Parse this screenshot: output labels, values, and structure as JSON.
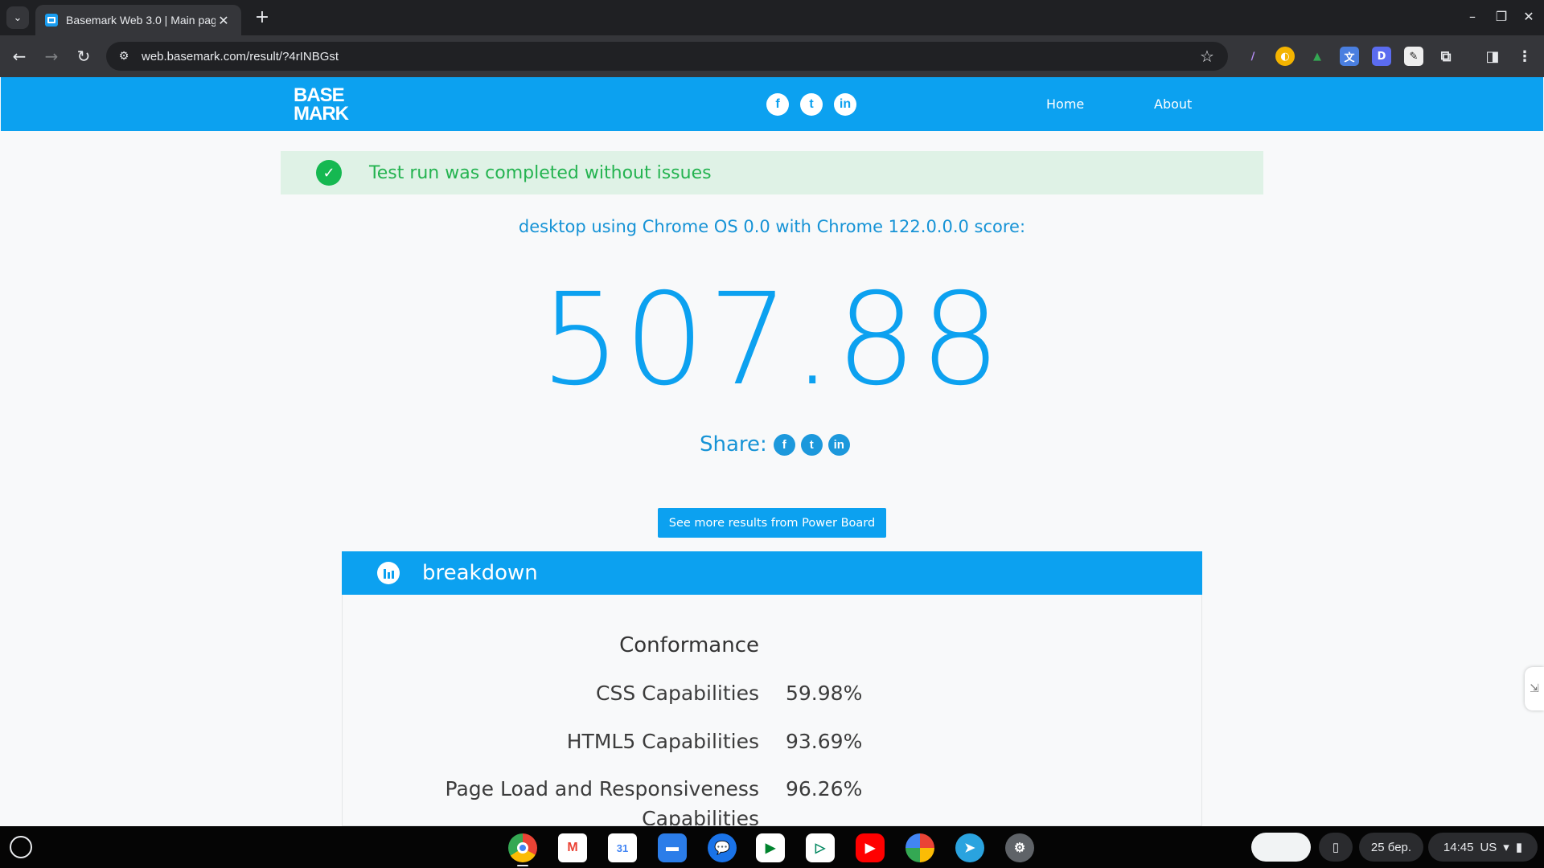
{
  "browser": {
    "tab_title": "Basemark Web 3.0 | Main page",
    "url": "web.basemark.com/result/?4rINBGst",
    "icons": [
      "chevron-down-icon",
      "close-icon",
      "plus-icon",
      "back-icon",
      "forward-icon",
      "reload-icon",
      "site-info-icon",
      "star-icon",
      "extensions-icon",
      "side-panel-icon",
      "menu-icon"
    ]
  },
  "site": {
    "logo_line1": "BASE",
    "logo_line2": "MARK",
    "nav": {
      "home": "Home",
      "about": "About"
    },
    "social": {
      "facebook": "f",
      "twitter": "t",
      "linkedin": "in"
    },
    "brand_color": "#0ca1f0"
  },
  "result": {
    "status": "Test run was completed without issues",
    "score_label": "desktop using Chrome OS 0.0 with Chrome 122.0.0.0 score:",
    "score": "507.88",
    "share_label": "Share:",
    "power_board_button": "See more results from Power Board"
  },
  "breakdown": {
    "title": "breakdown",
    "section_title": "Conformance",
    "metrics": [
      {
        "name": "CSS Capabilities",
        "value": "59.98%"
      },
      {
        "name": "HTML5 Capabilities",
        "value": "93.69%"
      },
      {
        "name": "Page Load and Responsiveness Capabilities",
        "value": "96.26%"
      }
    ]
  },
  "shelf": {
    "apps": [
      "Chrome",
      "Gmail",
      "Calendar",
      "Files",
      "Messages",
      "Meet",
      "Play Store",
      "YouTube",
      "Photos",
      "Telegram",
      "Settings"
    ],
    "calendar_day": "31",
    "date": "25 бер.",
    "time": "14:45",
    "locale": "US"
  }
}
